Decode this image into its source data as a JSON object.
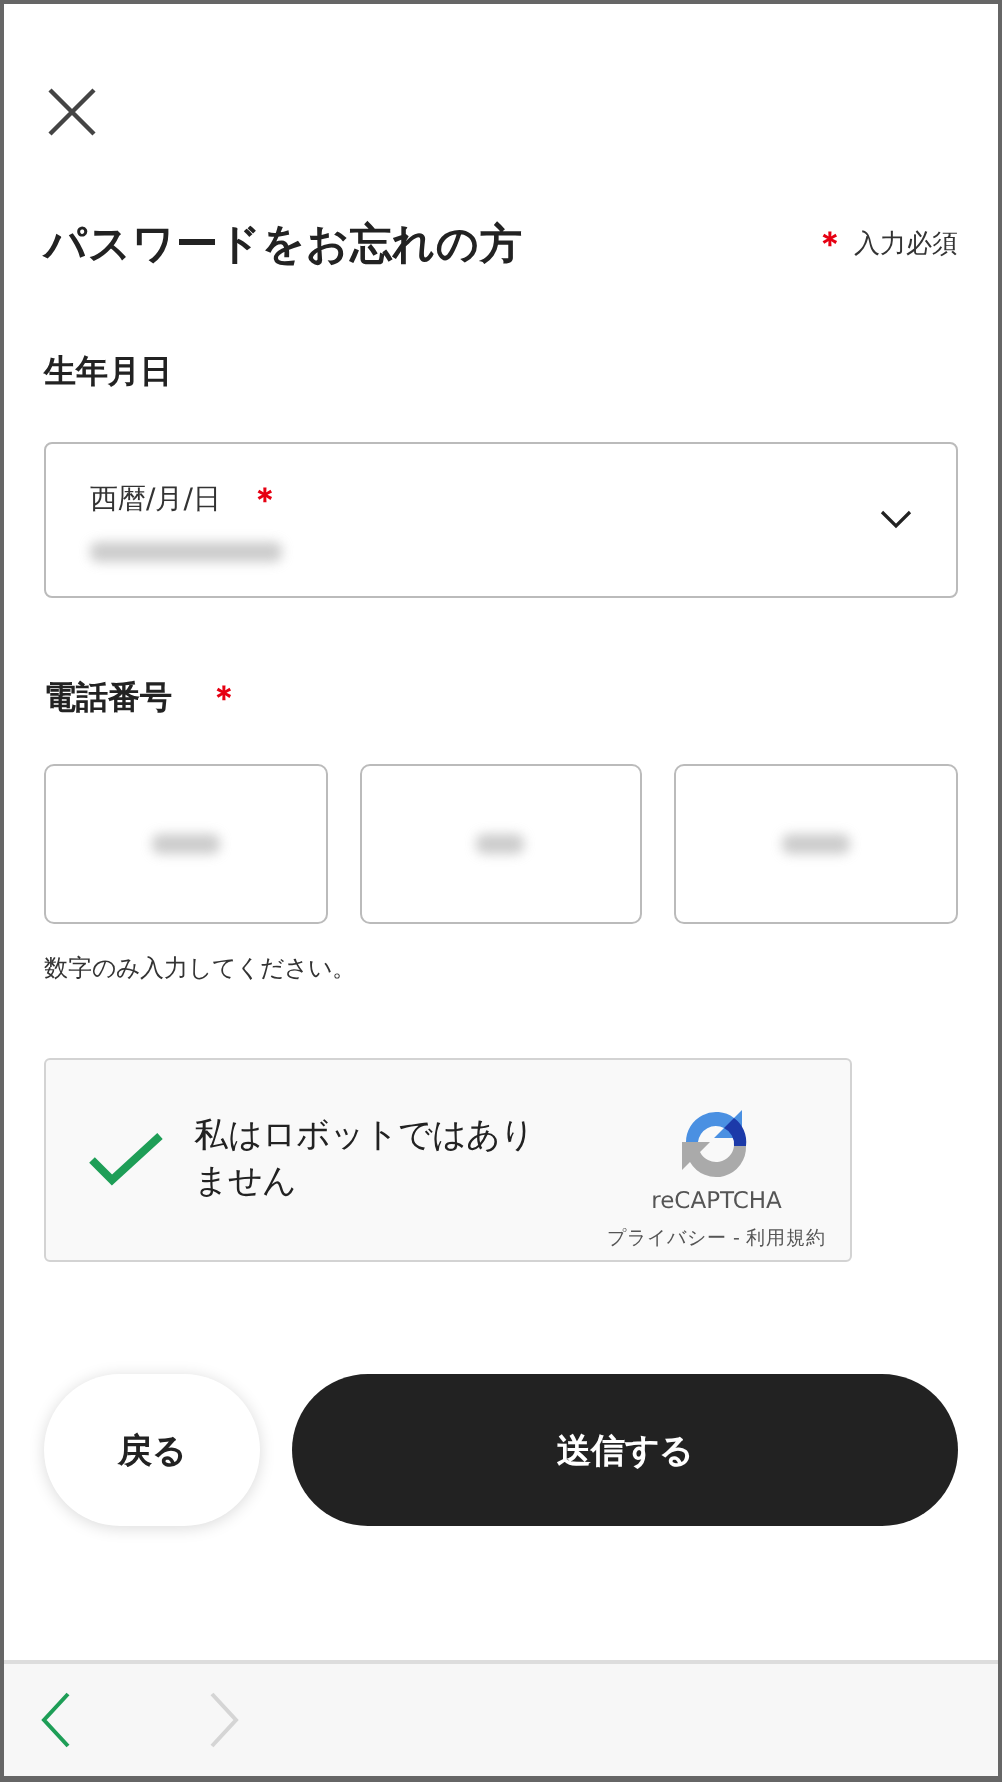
{
  "header": {
    "title": "パスワードをお忘れの方",
    "required_mark": "＊",
    "required_note": "入力必須"
  },
  "birthdate": {
    "label": "生年月日",
    "field_label": "西暦/月/日",
    "required": true
  },
  "phone": {
    "label": "電話番号",
    "required": true,
    "fields": [
      {
        "redacted": true
      },
      {
        "redacted": true
      },
      {
        "redacted": true
      }
    ],
    "hint": "数字のみ入力してください。"
  },
  "captcha": {
    "checked": true,
    "label": "私はロボットではありません",
    "brand": "reCAPTCHA",
    "links": "プライバシー - 利用規約"
  },
  "buttons": [
    {
      "kind": "secondary",
      "label": "戻る"
    },
    {
      "kind": "primary",
      "label": "送信する"
    }
  ],
  "nav": [
    {
      "kind": "back",
      "disabled": false
    },
    {
      "kind": "forward",
      "disabled": true
    }
  ]
}
